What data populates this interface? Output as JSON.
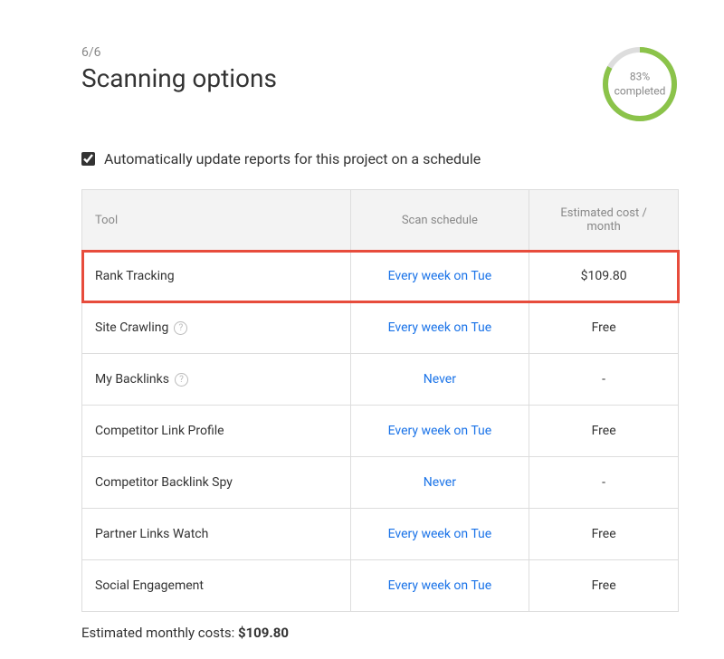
{
  "header": {
    "step": "6/6",
    "title": "Scanning options"
  },
  "progress": {
    "percent": 83,
    "percent_label": "83%",
    "completed_label": "completed"
  },
  "checkbox": {
    "label": "Automatically update reports for this project on a schedule",
    "checked": true
  },
  "table": {
    "headers": {
      "tool": "Tool",
      "schedule": "Scan schedule",
      "cost": "Estimated cost / month"
    },
    "rows": [
      {
        "tool": "Rank Tracking",
        "schedule": "Every week on Tue",
        "cost": "$109.80",
        "highlighted": true,
        "help": false
      },
      {
        "tool": "Site Crawling",
        "schedule": "Every week on Tue",
        "cost": "Free",
        "highlighted": false,
        "help": true
      },
      {
        "tool": "My Backlinks",
        "schedule": "Never",
        "cost": "-",
        "highlighted": false,
        "help": true
      },
      {
        "tool": "Competitor Link Profile",
        "schedule": "Every week on Tue",
        "cost": "Free",
        "highlighted": false,
        "help": false
      },
      {
        "tool": "Competitor Backlink Spy",
        "schedule": "Never",
        "cost": "-",
        "highlighted": false,
        "help": false
      },
      {
        "tool": "Partner Links Watch",
        "schedule": "Every week on Tue",
        "cost": "Free",
        "highlighted": false,
        "help": false
      },
      {
        "tool": "Social Engagement",
        "schedule": "Every week on Tue",
        "cost": "Free",
        "highlighted": false,
        "help": false
      }
    ]
  },
  "footer": {
    "label": "Estimated monthly costs:",
    "value": "$109.80"
  },
  "colors": {
    "progress_ring": "#8BC34A",
    "progress_bg": "#dddddd",
    "link": "#1a73e8",
    "highlight": "#e74c3c"
  }
}
